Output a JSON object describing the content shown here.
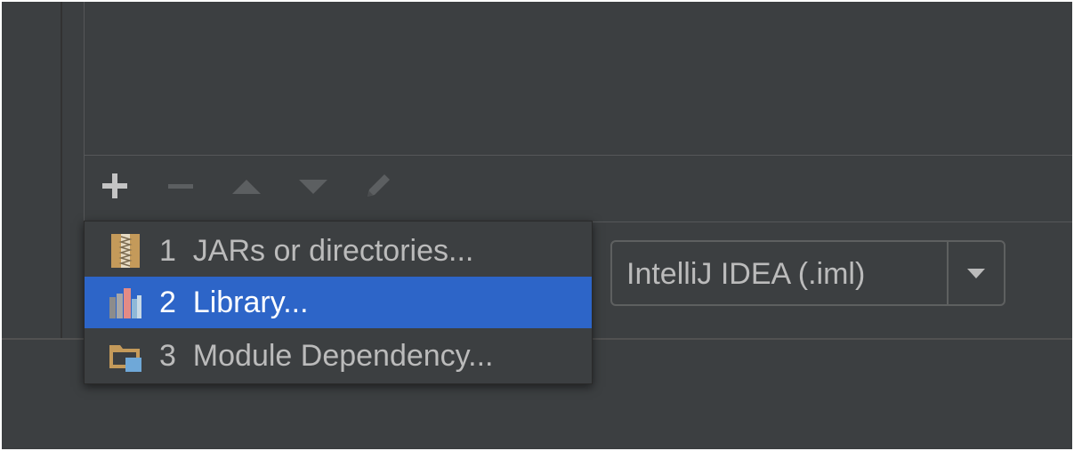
{
  "toolbar": {
    "buttons": [
      {
        "name": "add-button",
        "icon": "plus-icon",
        "enabled": true
      },
      {
        "name": "remove-button",
        "icon": "minus-icon",
        "enabled": false
      },
      {
        "name": "move-up-button",
        "icon": "triangle-up-icon",
        "enabled": false
      },
      {
        "name": "move-down-button",
        "icon": "triangle-down-icon",
        "enabled": false
      },
      {
        "name": "edit-button",
        "icon": "pencil-icon",
        "enabled": false
      }
    ]
  },
  "add_menu": {
    "items": [
      {
        "label": "1  JARs or directories...",
        "icon": "jar-archive-icon",
        "selected": false
      },
      {
        "label": "2  Library...",
        "icon": "library-books-icon",
        "selected": true
      },
      {
        "label": "3  Module Dependency...",
        "icon": "module-folder-icon",
        "selected": false
      }
    ]
  },
  "format_combo": {
    "value": "IntelliJ IDEA (.iml)",
    "icon": "triangle-down-icon"
  },
  "colors": {
    "background": "#3c3f41",
    "selection": "#2d65c8",
    "text": "#bbbbbb",
    "selected_text": "#ffffff"
  }
}
